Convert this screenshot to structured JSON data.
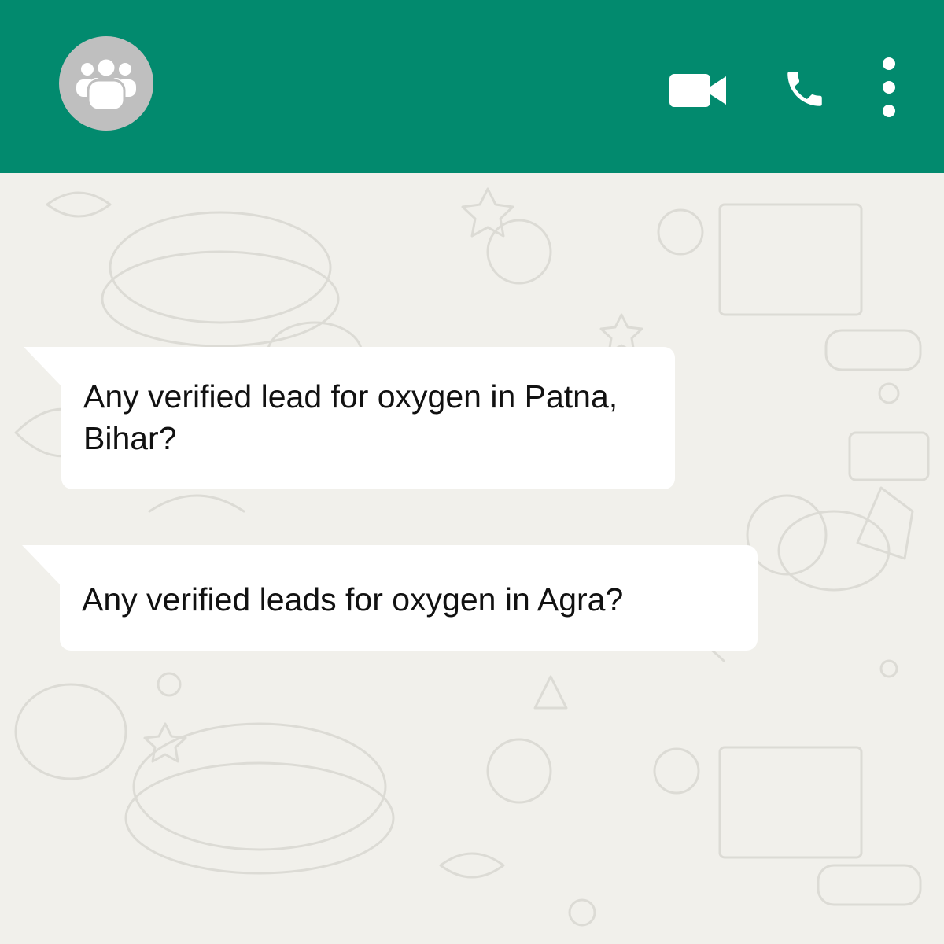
{
  "theme": {
    "header_color": "#028a6e",
    "background_color": "#f1f0eb",
    "bubble_color": "#ffffff",
    "avatar_color": "#bfbfbf",
    "icon_color": "#ffffff"
  },
  "header": {
    "avatar_icon": "group-icon",
    "actions": [
      {
        "icon": "video-call-icon"
      },
      {
        "icon": "phone-call-icon"
      },
      {
        "icon": "more-options-icon"
      }
    ]
  },
  "messages": [
    {
      "text": "Any verified lead for oxygen in Patna, Bihar?"
    },
    {
      "text": "Any verified leads for oxygen in Agra?"
    }
  ]
}
